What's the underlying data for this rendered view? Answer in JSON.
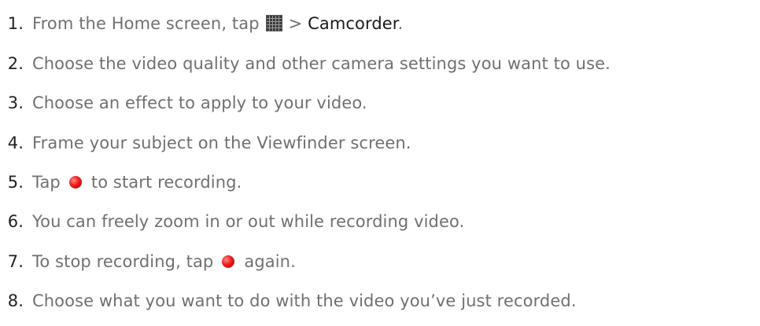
{
  "steps": [
    {
      "num": "1.",
      "pre": "From the Home screen, tap",
      "icon": "apps-grid-icon",
      "post": "> ",
      "strong": "Camcorder",
      "tail": "."
    },
    {
      "num": "2.",
      "text": "Choose the video quality and other camera settings you want to use."
    },
    {
      "num": "3.",
      "text": "Choose an effect to apply to your video."
    },
    {
      "num": "4.",
      "text": "Frame your subject on the Viewfinder screen."
    },
    {
      "num": "5.",
      "pre": "Tap",
      "icon": "record-icon",
      "post": "to start recording."
    },
    {
      "num": "6.",
      "text": "You can freely zoom in or out while recording video."
    },
    {
      "num": "7.",
      "pre": "To stop recording, tap",
      "icon": "record-icon",
      "post": "again."
    },
    {
      "num": "8.",
      "text": "Choose what you want to do with the video you’ve just recorded."
    }
  ],
  "colors": {
    "text": "#707070",
    "number": "#222222",
    "emphasis": "#1a1a1a",
    "record": "#ee1c1c"
  }
}
